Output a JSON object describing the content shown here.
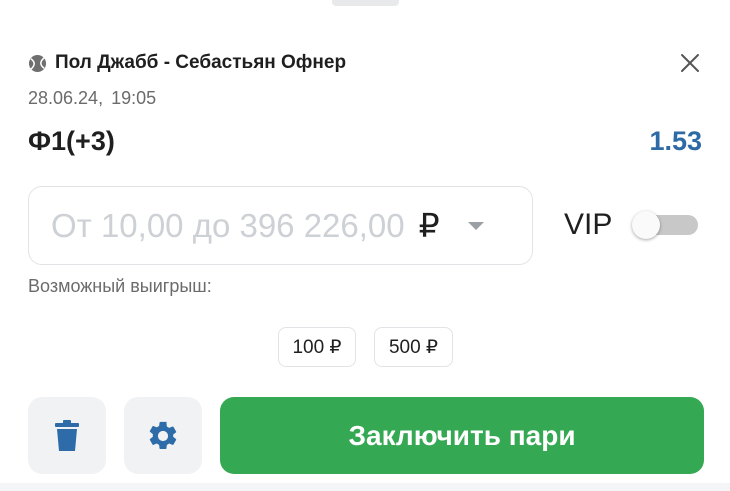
{
  "match": {
    "title": "Пол Джабб - Себастьян Офнер",
    "date": "28.06.24,",
    "time": "19:05",
    "sport_icon": "tennis-ball-icon"
  },
  "bet": {
    "outcome": "Ф1(+3)",
    "odds": "1.53"
  },
  "stake": {
    "placeholder": "От 10,00 до 396 226,00",
    "currency": "₽"
  },
  "vip": {
    "label": "VIP",
    "enabled": false
  },
  "possible_win_label": "Возможный выигрыш:",
  "quick_amounts": [
    "100 ₽",
    "500 ₽"
  ],
  "actions": {
    "submit_label": "Заключить пари",
    "delete_icon": "trash-icon",
    "settings_icon": "gear-icon"
  },
  "colors": {
    "accent_green": "#34a853",
    "odds_blue": "#2e6aa5",
    "icon_blue": "#2d6ca8"
  }
}
